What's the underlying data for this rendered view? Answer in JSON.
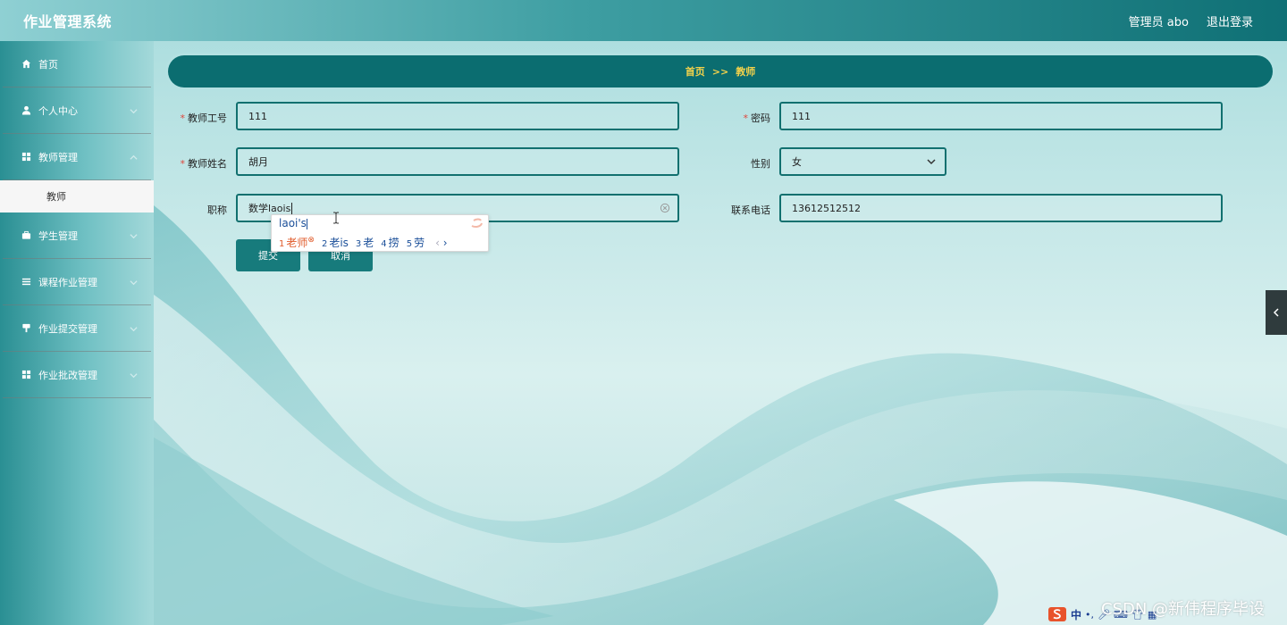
{
  "header": {
    "title": "作业管理系统",
    "user_label": "管理员 abo",
    "logout_label": "退出登录"
  },
  "sidebar": {
    "items": [
      {
        "label": "首页",
        "icon": "home-icon"
      },
      {
        "label": "个人中心",
        "icon": "user-icon"
      },
      {
        "label": "教师管理",
        "icon": "grid-icon"
      },
      {
        "label": "学生管理",
        "icon": "briefcase-icon"
      },
      {
        "label": "课程作业管理",
        "icon": "list-icon"
      },
      {
        "label": "作业提交管理",
        "icon": "upload-icon"
      },
      {
        "label": "作业批改管理",
        "icon": "grid-icon"
      }
    ],
    "active_sub": "教师"
  },
  "breadcrumb": {
    "home": "首页",
    "separator": ">>",
    "current": "教师"
  },
  "form": {
    "teacher_id": {
      "label": "教师工号",
      "value": "111"
    },
    "password": {
      "label": "密码",
      "value": "111"
    },
    "teacher_name": {
      "label": "教师姓名",
      "value": "胡月"
    },
    "gender": {
      "label": "性别",
      "value": "女"
    },
    "title": {
      "label": "职称",
      "value": "数学laois"
    },
    "phone": {
      "label": "联系电话",
      "value": "13612512512"
    },
    "submit_label": "提交",
    "cancel_label": "取消"
  },
  "ime": {
    "composition": "laoi's",
    "candidates": [
      {
        "num": "1",
        "text": "老师"
      },
      {
        "num": "2",
        "text": "老is"
      },
      {
        "num": "3",
        "text": "老"
      },
      {
        "num": "4",
        "text": "捞"
      },
      {
        "num": "5",
        "text": "劳"
      }
    ]
  },
  "tray": {
    "lang": "中"
  },
  "watermark": "CSDN @新伟程序毕设",
  "colors": {
    "header_dark": "#0f7075",
    "breadcrumb_bg": "#0b6d70",
    "breadcrumb_text": "#f3d24b",
    "input_border": "#11706f",
    "button_bg": "#177b7c",
    "required": "#e0453b"
  }
}
